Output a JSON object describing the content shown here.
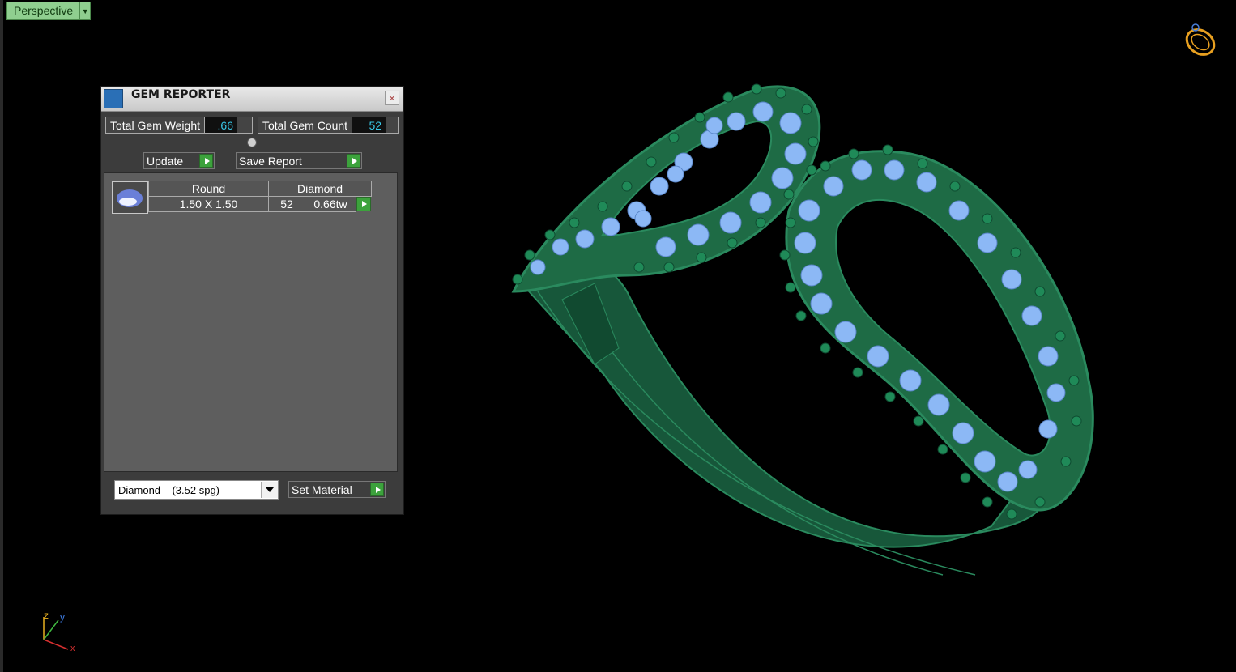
{
  "viewport": {
    "view_name": "Perspective",
    "axis": {
      "x": "x",
      "y": "y",
      "z": "z"
    }
  },
  "gem_reporter": {
    "title": "GEM REPORTER",
    "close": "×",
    "total_weight_label": "Total Gem Weight",
    "total_weight_value": ".66",
    "total_count_label": "Total Gem Count",
    "total_count_value": "52",
    "update_label": "Update",
    "save_report_label": "Save Report",
    "row": {
      "shape": "Round",
      "material": "Diamond",
      "size": "1.50 X 1.50",
      "count": "52",
      "weight": "0.66tw"
    },
    "material_select": "Diamond    (3.52 spg)",
    "set_material_label": "Set Material"
  },
  "colors": {
    "metal": "#1e6b45",
    "gem": "#8cb8f5",
    "accent": "#3ca23c"
  }
}
